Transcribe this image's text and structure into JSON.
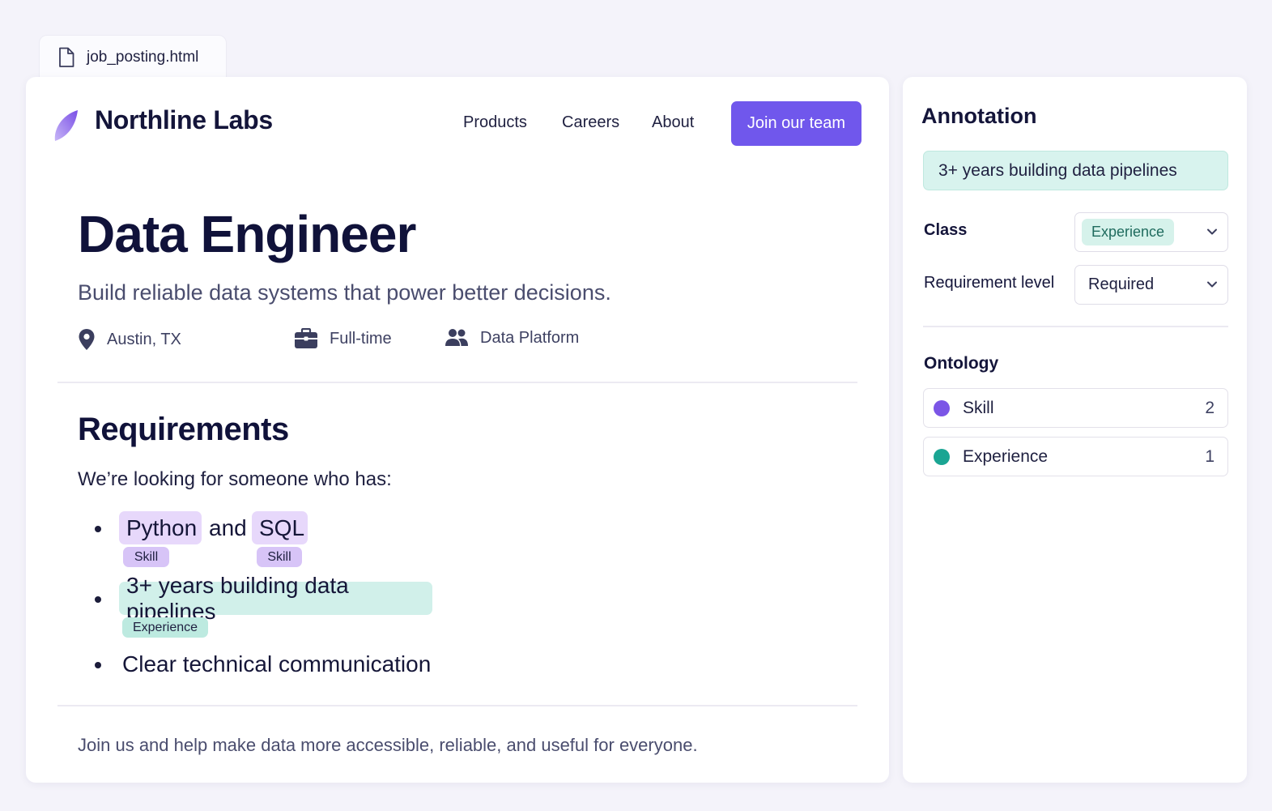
{
  "file_tab": {
    "filename": "job_posting.html",
    "icon": "document-icon"
  },
  "header": {
    "brand": "Northline Labs",
    "logo_icon": "leaf-logo-icon",
    "nav": [
      "Products",
      "Careers",
      "About"
    ],
    "cta": "Join our team"
  },
  "job": {
    "title": "Data Engineer",
    "subtitle": "Build reliable data systems that power better decisions.",
    "meta": [
      {
        "icon": "map-pin-icon",
        "text": "Austin, TX"
      },
      {
        "icon": "briefcase-icon",
        "text": "Full-time"
      },
      {
        "icon": "users-icon",
        "text": "Data Platform"
      }
    ]
  },
  "requirements": {
    "heading": "Requirements",
    "intro": "We’re looking for someone who has:",
    "items": [
      {
        "spans": [
          {
            "text": "Python",
            "tag": "Skill"
          },
          {
            "text": "and"
          },
          {
            "text": "SQL",
            "tag": "Skill"
          }
        ]
      },
      {
        "spans": [
          {
            "text": "3+ years building data pipelines",
            "tag": "Experience"
          }
        ]
      },
      {
        "spans": [
          {
            "text": "Clear technical communication"
          }
        ]
      }
    ]
  },
  "footer_text": "Join us and help make data more accessible, reliable, and useful for everyone.",
  "annotation": {
    "heading": "Annotation",
    "selected_text": "3+ years building data pipelines",
    "class_label": "Class",
    "class_value": "Experience",
    "level_label": "Requirement level",
    "level_value": "Required",
    "ontology_heading": "Ontology",
    "ontology": [
      {
        "name": "Skill",
        "count": "2",
        "color": "#7b55e6"
      },
      {
        "name": "Experience",
        "count": "1",
        "color": "#1aa593"
      }
    ]
  },
  "colors": {
    "accent": "#7057ec",
    "skill_highlight": "#e7d8fb",
    "experience_highlight": "#d1f0ea",
    "background": "#f4f3fa"
  }
}
